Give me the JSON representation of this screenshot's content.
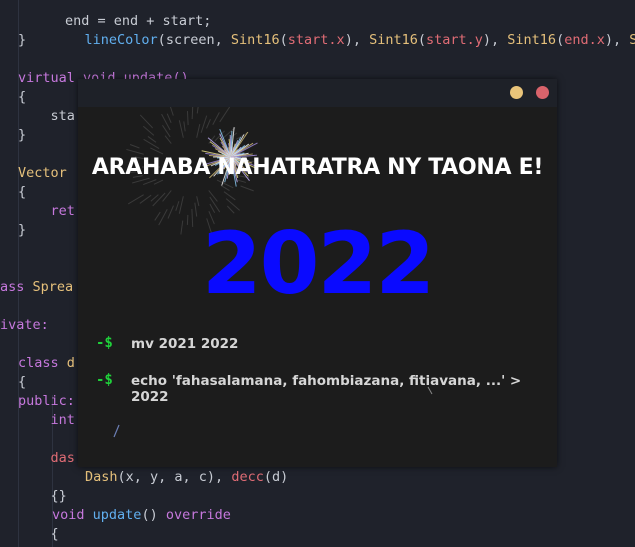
{
  "code": {
    "line_top": "    end = end + start;",
    "line_linecolor": {
      "fn": "lineColor",
      "args": [
        "screen",
        "Sint16",
        "start.x",
        "Sint16",
        "start.y",
        "Sint16",
        "end.x",
        "Si"
      ]
    },
    "close_brace": "}",
    "virtual_kw": "virtual",
    "virtual_rest": " void update()",
    "open_brace": "{",
    "sta": "    sta",
    "vector": "Vector",
    "ret": "    ret",
    "class_kw": "ass",
    "class_name": " Sprea",
    "private": "ivate:",
    "inner_class_kw": "class",
    "inner_class": " d",
    "public": "public:",
    "int": "    int",
    "das": "    das",
    "dash_ctor": {
      "name": "Dash",
      "args": "(x, y, a, c), ",
      "init": "decc",
      "init_arg": "(d)"
    },
    "empty_body": "    {}",
    "void_kw": "void",
    "update_fn": "update",
    "override_kw": "override",
    "last_brace": "    {"
  },
  "window": {
    "headline": "ARAHABA NAHATRATRA NY TAONA E!",
    "year": "2022",
    "prompts": [
      {
        "symbol": "-$",
        "command": "mv 2021 2022"
      },
      {
        "symbol": "-$",
        "command": "echo 'fahasalamana, fahombiazana, fitiavana, ...' > 2022"
      }
    ],
    "colors": {
      "year": "#0a0aff",
      "prompt": "#1fd13a",
      "minimize": "#e9c47a",
      "close": "#d9636b"
    }
  }
}
